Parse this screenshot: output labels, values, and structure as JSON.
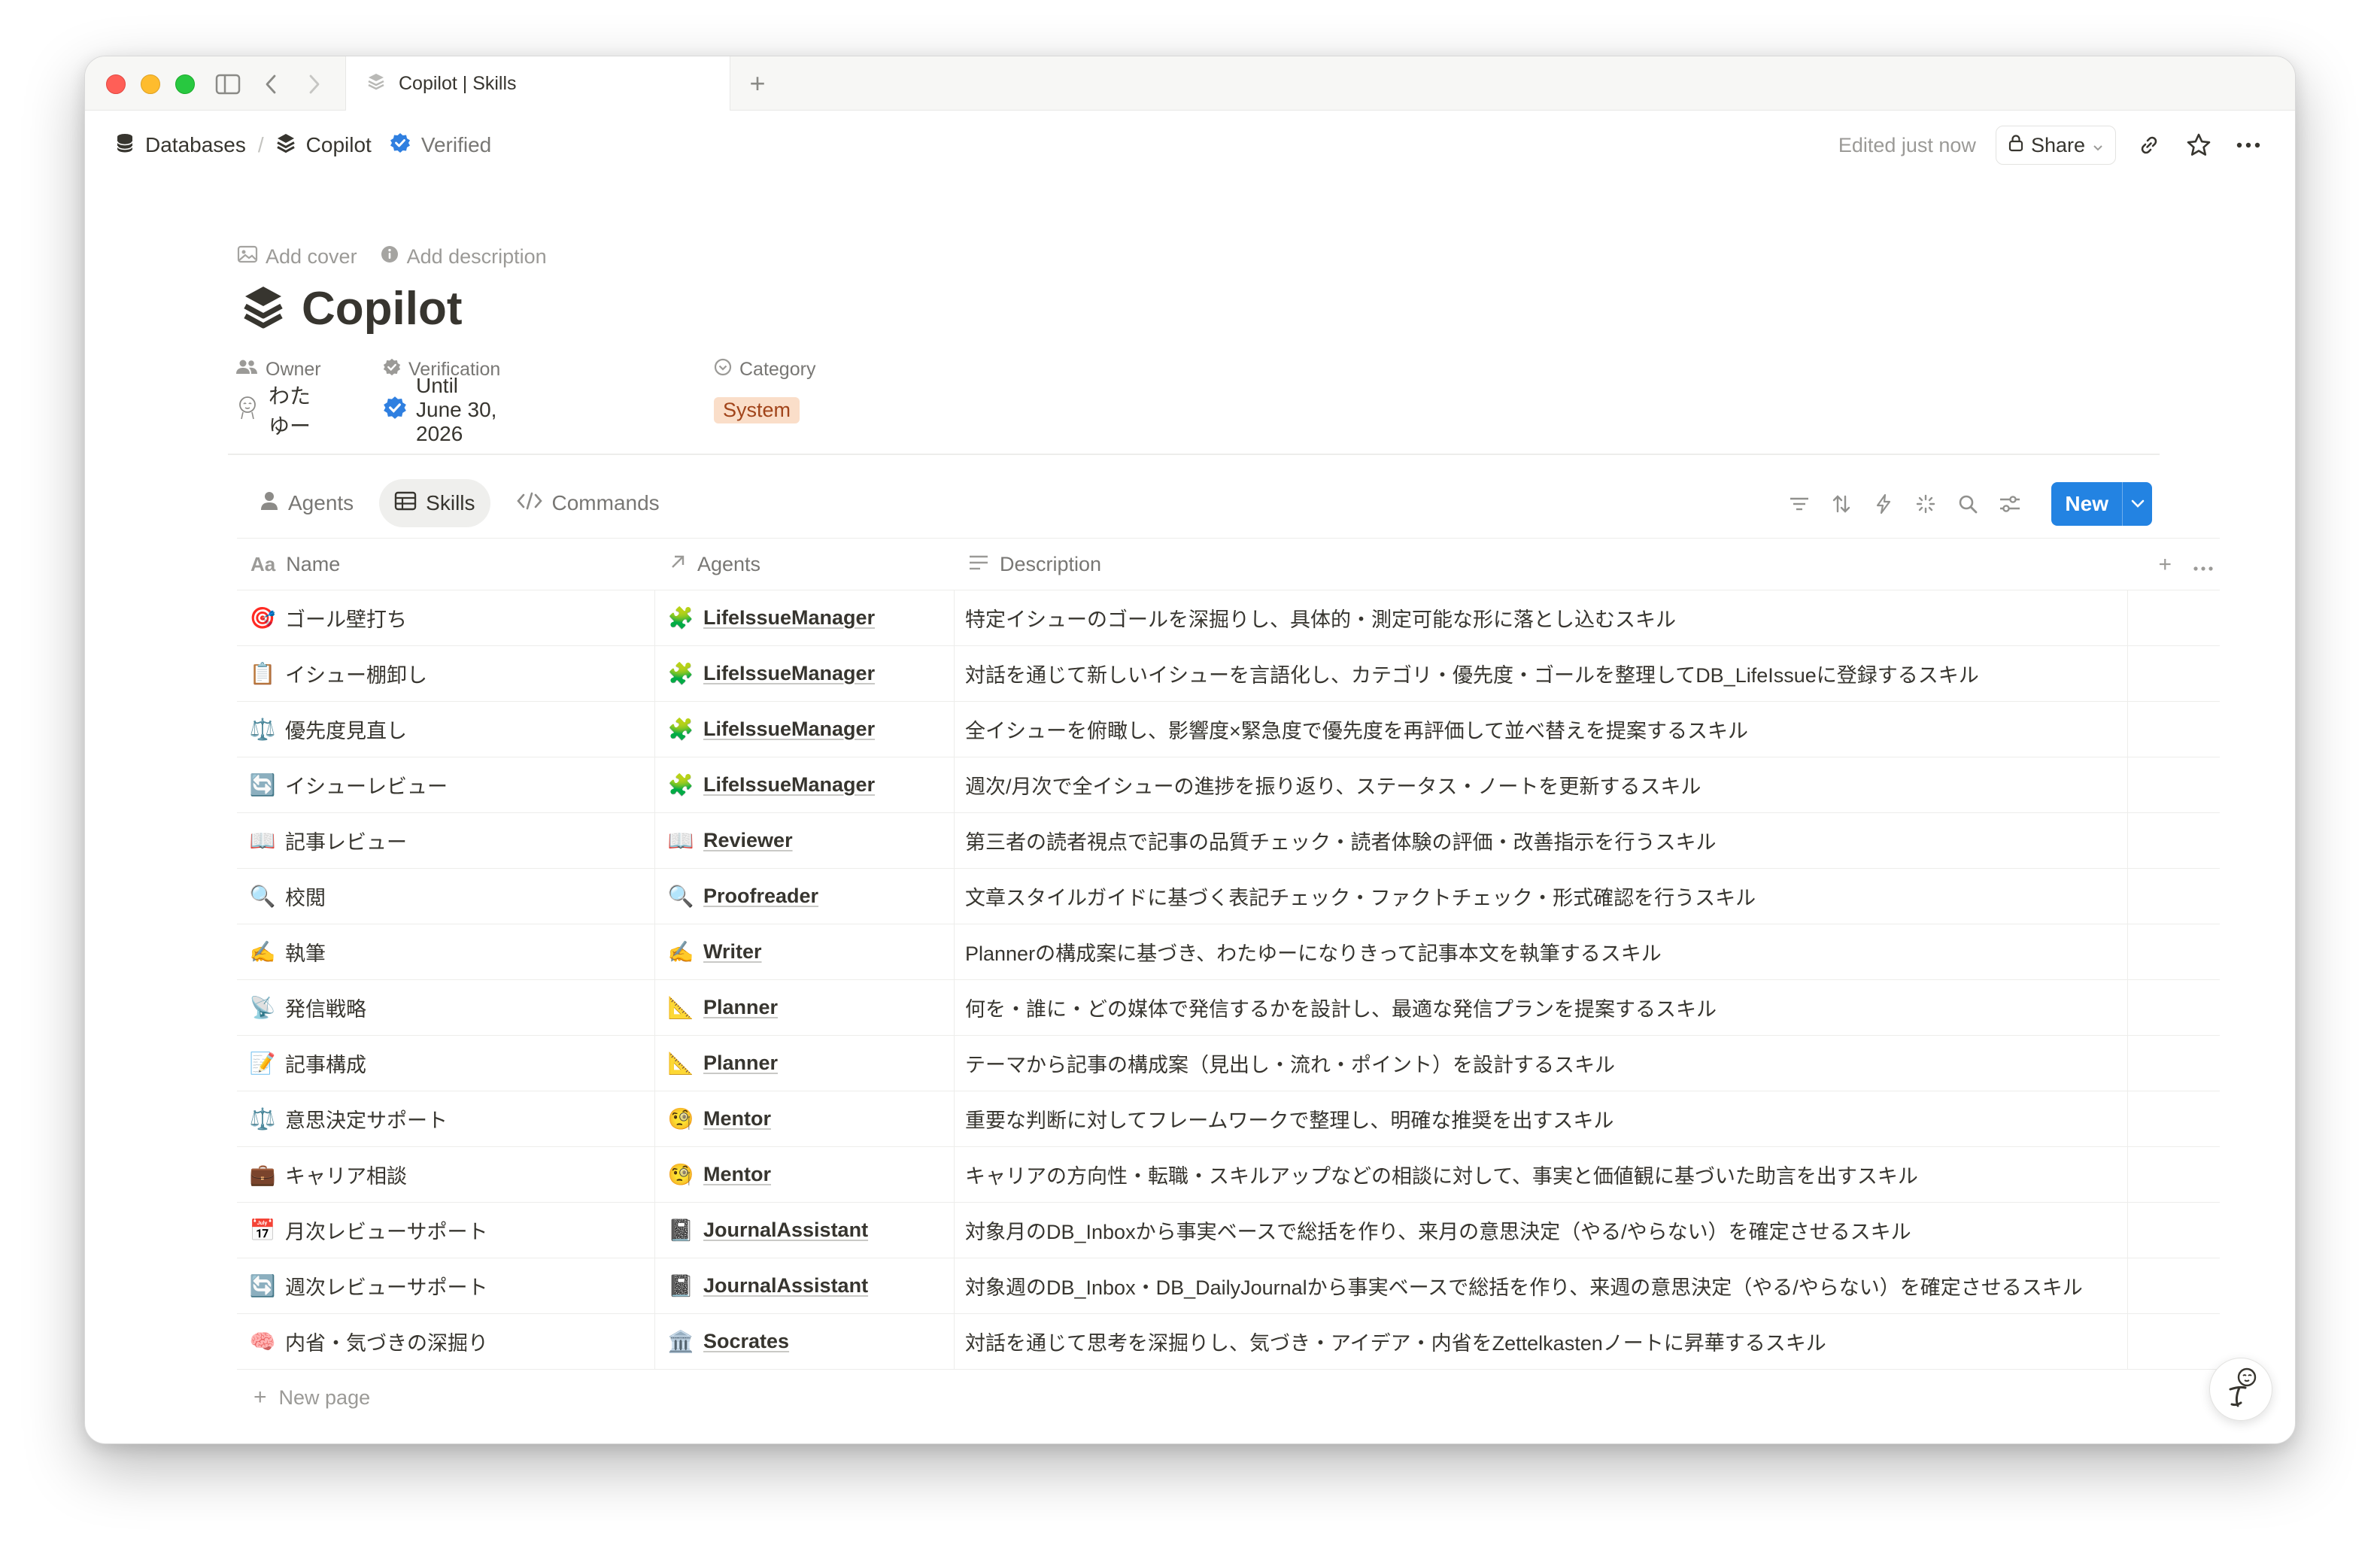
{
  "tab": {
    "title": "Copilot | Skills"
  },
  "breadcrumb": {
    "root": "Databases",
    "current": "Copilot",
    "verified": "Verified"
  },
  "topbar": {
    "edited": "Edited just now",
    "share": "Share"
  },
  "page": {
    "add_cover": "Add cover",
    "add_description": "Add description",
    "title": "Copilot"
  },
  "properties": {
    "owner_label": "Owner",
    "owner_value": "わたゆー",
    "verification_label": "Verification",
    "verification_value": "Until June 30, 2026",
    "category_label": "Category",
    "category_value": "System"
  },
  "views": [
    {
      "label": "Agents",
      "icon": "person-icon"
    },
    {
      "label": "Skills",
      "icon": "table-icon",
      "active": true
    },
    {
      "label": "Commands",
      "icon": "code-icon"
    }
  ],
  "toolbar": {
    "new_label": "New"
  },
  "columns": {
    "name": "Name",
    "agents": "Agents",
    "description": "Description"
  },
  "rows": [
    {
      "emoji": "🎯",
      "name": "ゴール壁打ち",
      "agent_emoji": "🧩",
      "agent": "LifeIssueManager",
      "description": "特定イシューのゴールを深掘りし、具体的・測定可能な形に落とし込むスキル"
    },
    {
      "emoji": "📋",
      "name": "イシュー棚卸し",
      "agent_emoji": "🧩",
      "agent": "LifeIssueManager",
      "description": "対話を通じて新しいイシューを言語化し、カテゴリ・優先度・ゴールを整理してDB_LifeIssueに登録するスキル"
    },
    {
      "emoji": "⚖️",
      "name": "優先度見直し",
      "agent_emoji": "🧩",
      "agent": "LifeIssueManager",
      "description": "全イシューを俯瞰し、影響度×緊急度で優先度を再評価して並べ替えを提案するスキル"
    },
    {
      "emoji": "🔄",
      "name": "イシューレビュー",
      "agent_emoji": "🧩",
      "agent": "LifeIssueManager",
      "description": "週次/月次で全イシューの進捗を振り返り、ステータス・ノートを更新するスキル"
    },
    {
      "emoji": "📖",
      "name": "記事レビュー",
      "agent_emoji": "📖",
      "agent": "Reviewer",
      "description": "第三者の読者視点で記事の品質チェック・読者体験の評価・改善指示を行うスキル"
    },
    {
      "emoji": "🔍",
      "name": "校閲",
      "agent_emoji": "🔍",
      "agent": "Proofreader",
      "description": "文章スタイルガイドに基づく表記チェック・ファクトチェック・形式確認を行うスキル"
    },
    {
      "emoji": "✍️",
      "name": "執筆",
      "agent_emoji": "✍️",
      "agent": "Writer",
      "description": "Plannerの構成案に基づき、わたゆーになりきって記事本文を執筆するスキル"
    },
    {
      "emoji": "📡",
      "name": "発信戦略",
      "agent_emoji": "📐",
      "agent": "Planner",
      "description": "何を・誰に・どの媒体で発信するかを設計し、最適な発信プランを提案するスキル"
    },
    {
      "emoji": "📝",
      "name": "記事構成",
      "agent_emoji": "📐",
      "agent": "Planner",
      "description": "テーマから記事の構成案（見出し・流れ・ポイント）を設計するスキル"
    },
    {
      "emoji": "⚖️",
      "name": "意思決定サポート",
      "agent_emoji": "🧐",
      "agent": "Mentor",
      "description": "重要な判断に対してフレームワークで整理し、明確な推奨を出すスキル"
    },
    {
      "emoji": "💼",
      "name": "キャリア相談",
      "agent_emoji": "🧐",
      "agent": "Mentor",
      "description": "キャリアの方向性・転職・スキルアップなどの相談に対して、事実と価値観に基づいた助言を出すスキル"
    },
    {
      "emoji": "📅",
      "name": "月次レビューサポート",
      "agent_emoji": "📓",
      "agent": "JournalAssistant",
      "description": "対象月のDB_Inboxから事実ベースで総括を作り、来月の意思決定（やる/やらない）を確定させるスキル"
    },
    {
      "emoji": "🔄",
      "name": "週次レビューサポート",
      "agent_emoji": "📓",
      "agent": "JournalAssistant",
      "description": "対象週のDB_Inbox・DB_DailyJournalから事実ベースで総括を作り、来週の意思決定（やる/やらない）を確定させるスキル"
    },
    {
      "emoji": "🧠",
      "name": "内省・気づきの深掘り",
      "agent_emoji": "🏛️",
      "agent": "Socrates",
      "description": "対話を通じて思考を深掘りし、気づき・アイデア・内省をZettelkastenノートに昇華するスキル"
    }
  ],
  "footer": {
    "new_page": "New page"
  }
}
